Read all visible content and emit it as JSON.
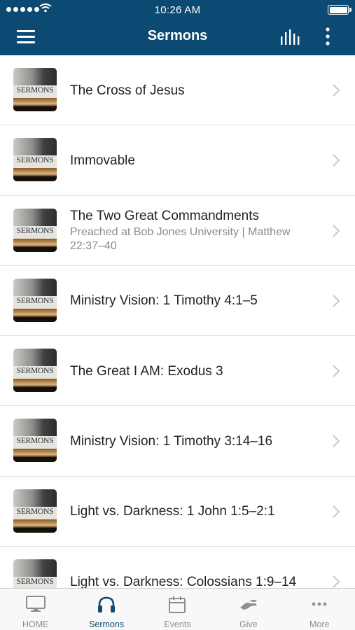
{
  "status_bar": {
    "time": "10:26 AM"
  },
  "nav": {
    "title": "Sermons"
  },
  "thumbnail_label": "SERMONS",
  "sermons": [
    {
      "title": "The Cross of Jesus",
      "subtitle": ""
    },
    {
      "title": "Immovable",
      "subtitle": ""
    },
    {
      "title": "The Two Great Commandments",
      "subtitle": "Preached at Bob Jones University | Matthew 22:37–40"
    },
    {
      "title": "Ministry Vision: 1 Timothy 4:1–5",
      "subtitle": ""
    },
    {
      "title": "The Great I AM: Exodus 3",
      "subtitle": ""
    },
    {
      "title": "Ministry Vision: 1 Timothy 3:14–16",
      "subtitle": ""
    },
    {
      "title": "Light vs. Darkness: 1 John 1:5–2:1",
      "subtitle": ""
    },
    {
      "title": "Light vs. Darkness: Colossians 1:9–14",
      "subtitle": ""
    }
  ],
  "tabs": [
    {
      "label": "HOME",
      "icon": "monitor-icon",
      "active": false
    },
    {
      "label": "Sermons",
      "icon": "headphones-icon",
      "active": true
    },
    {
      "label": "Events",
      "icon": "calendar-icon",
      "active": false
    },
    {
      "label": "Give",
      "icon": "giving-hand-icon",
      "active": false
    },
    {
      "label": "More",
      "icon": "ellipsis-icon",
      "active": false
    }
  ],
  "colors": {
    "header": "#0d4a73",
    "active_tab": "#0d4a73",
    "inactive_tab": "#8e8e8e"
  }
}
